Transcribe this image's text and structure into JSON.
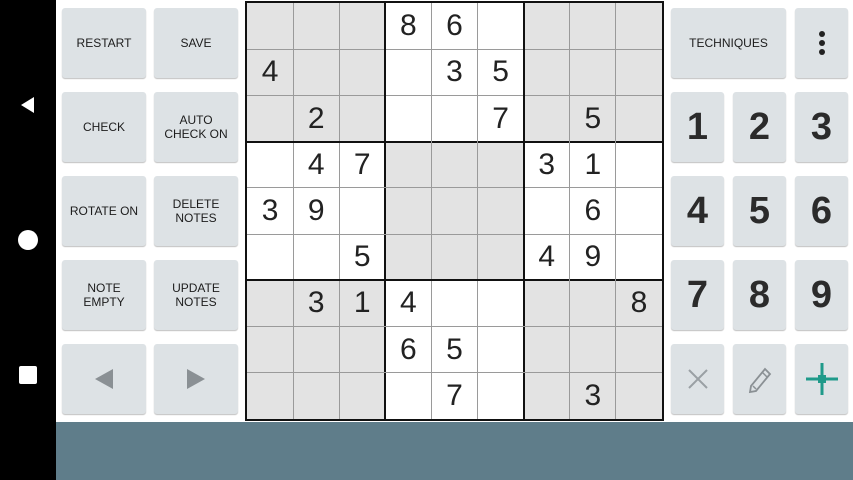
{
  "left_controls": {
    "restart": "RESTART",
    "save": "SAVE",
    "check": "CHECK",
    "auto_check": "AUTO CHECK ON",
    "rotate": "ROTATE ON",
    "delete_notes": "DELETE NOTES",
    "note_empty": "NOTE EMPTY",
    "update_notes": "UPDATE NOTES",
    "prev_icon": "triangle-left-icon",
    "next_icon": "triangle-right-icon"
  },
  "right_controls": {
    "techniques": "TECHNIQUES",
    "menu_icon": "more-vert-icon",
    "numbers": [
      "1",
      "2",
      "3",
      "4",
      "5",
      "6",
      "7",
      "8",
      "9"
    ],
    "erase_icon": "close-icon",
    "pencil_icon": "pencil-icon",
    "hint_icon": "crosshair-icon"
  },
  "board": {
    "rows": [
      [
        "",
        "",
        "",
        "8",
        "6",
        "",
        "",
        "",
        ""
      ],
      [
        "4",
        "",
        "",
        "",
        "3",
        "5",
        "",
        "",
        ""
      ],
      [
        "",
        "2",
        "",
        "",
        "",
        "7",
        "",
        "5",
        ""
      ],
      [
        "",
        "4",
        "7",
        "",
        "",
        "",
        "3",
        "1",
        ""
      ],
      [
        "3",
        "9",
        "",
        "",
        "",
        "",
        "",
        "6",
        ""
      ],
      [
        "",
        "",
        "5",
        "",
        "",
        "",
        "4",
        "9",
        ""
      ],
      [
        "",
        "3",
        "1",
        "4",
        "",
        "",
        "",
        "",
        "8"
      ],
      [
        "",
        "",
        "",
        "6",
        "5",
        "",
        "",
        "",
        ""
      ],
      [
        "",
        "",
        "",
        "",
        "7",
        "",
        "",
        "3",
        ""
      ]
    ],
    "shaded_color": "#e3e3e3",
    "white_color": "#ffffff"
  },
  "system_nav": {
    "back_icon": "back-triangle-icon",
    "home_icon": "home-circle-icon",
    "recents_icon": "recents-square-icon"
  },
  "colors": {
    "button_bg": "#dde2e5",
    "bottom_bar": "#5f7d8a",
    "accent": "#1f9a8a"
  }
}
